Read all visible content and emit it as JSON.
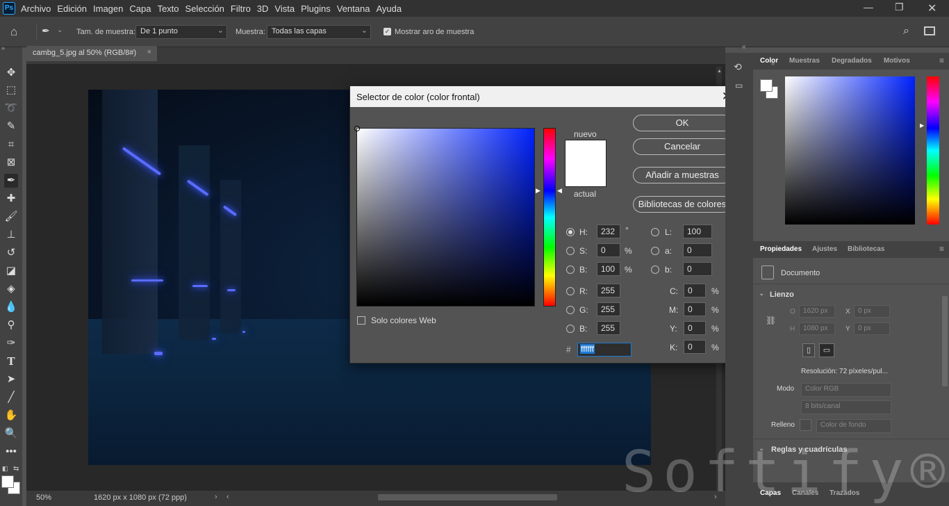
{
  "app": {
    "logo": "Ps"
  },
  "menu": [
    "Archivo",
    "Edición",
    "Imagen",
    "Capa",
    "Texto",
    "Selección",
    "Filtro",
    "3D",
    "Vista",
    "Plugins",
    "Ventana",
    "Ayuda"
  ],
  "options": {
    "sample_size_label": "Tam. de muestra:",
    "sample_size_value": "De 1 punto",
    "sample_label": "Muestra:",
    "sample_value": "Todas las capas",
    "show_ring_label": "Mostrar aro de muestra",
    "show_ring_checked": true
  },
  "document": {
    "tab_title": "cambg_5.jpg al 50% (RGB/8#)",
    "zoom": "50%",
    "info": "1620 px x 1080 px (72 ppp)"
  },
  "color_picker": {
    "title": "Selector de color (color frontal)",
    "new_label": "nuevo",
    "current_label": "actual",
    "buttons": {
      "ok": "OK",
      "cancel": "Cancelar",
      "add_swatches": "Añadir a muestras",
      "libraries": "Bibliotecas de colores"
    },
    "web_only_label": "Solo colores Web",
    "H": {
      "label": "H:",
      "value": "232",
      "unit": "°"
    },
    "S": {
      "label": "S:",
      "value": "0",
      "unit": "%"
    },
    "Bv": {
      "label": "B:",
      "value": "100",
      "unit": "%"
    },
    "R": {
      "label": "R:",
      "value": "255"
    },
    "G": {
      "label": "G:",
      "value": "255"
    },
    "Bc": {
      "label": "B:",
      "value": "255"
    },
    "L": {
      "label": "L:",
      "value": "100"
    },
    "a": {
      "label": "a:",
      "value": "0"
    },
    "b": {
      "label": "b:",
      "value": "0"
    },
    "C": {
      "label": "C:",
      "value": "0",
      "unit": "%"
    },
    "M": {
      "label": "M:",
      "value": "0",
      "unit": "%"
    },
    "Y": {
      "label": "Y:",
      "value": "0",
      "unit": "%"
    },
    "K": {
      "label": "K:",
      "value": "0",
      "unit": "%"
    },
    "hash": "#",
    "hex": "ffffff",
    "hue_color": "#0022ff"
  },
  "color_panel": {
    "tabs": [
      "Color",
      "Muestras",
      "Degradados",
      "Motivos"
    ]
  },
  "properties_panel": {
    "tabs": [
      "Propiedades",
      "Ajustes",
      "Bibliotecas"
    ],
    "doc_label": "Documento",
    "canvas_section": "Lienzo",
    "w_label": "O",
    "w_value": "1620 px",
    "h_label": "H",
    "h_value": "1080 px",
    "x_label": "X",
    "x_value": "0 px",
    "y_label": "Y",
    "y_value": "0 px",
    "resolution": "Resolución: 72 píxeles/pul...",
    "mode_label": "Modo",
    "mode_value": "Color RGB",
    "bits_value": "8 bits/canal",
    "fill_label": "Relleno",
    "fill_value": "Color de fondo",
    "rulers_section": "Reglas y cuadrículas"
  },
  "layers_panel": {
    "tabs": [
      "Capas",
      "Canales",
      "Trazados"
    ]
  },
  "watermark": "Softify®"
}
